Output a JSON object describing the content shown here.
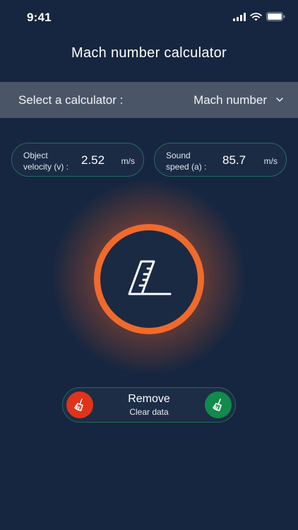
{
  "status_bar": {
    "time": "9:41",
    "icons": [
      "cellular-signal-icon",
      "wifi-icon",
      "battery-icon"
    ]
  },
  "header": {
    "title": "Mach number calculator"
  },
  "selector": {
    "label": "Select a calculator :",
    "value": "Mach number",
    "icon": "chevron-down-icon"
  },
  "inputs": [
    {
      "label": "Object\nvelocity (v) :",
      "value": "2.52",
      "unit": "m/s"
    },
    {
      "label": "Sound\nspeed (a) :",
      "value": "85.7",
      "unit": "m/s"
    }
  ],
  "calculate_button": {
    "icon": "ruler-pencil-icon"
  },
  "remove": {
    "title": "Remove",
    "subtitle": "Clear data",
    "icons": [
      "broom-icon",
      "broom-icon"
    ]
  },
  "colors": {
    "background": "#162640",
    "selector_bar": "#4a5668",
    "accent_orange": "#f06a2c",
    "pill_border": "#2a6a63",
    "clear_red": "#e0331a",
    "clear_green": "#128a4c"
  }
}
